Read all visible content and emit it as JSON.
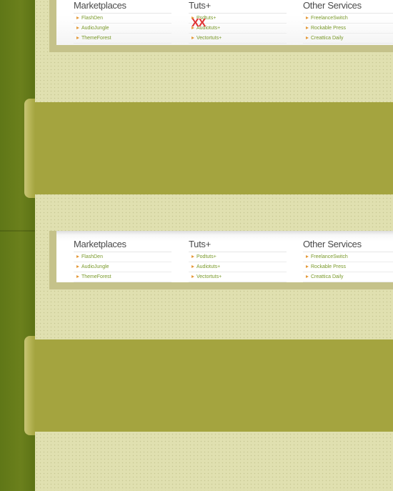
{
  "footer_top": {
    "columns": [
      {
        "title": "Marketplaces",
        "links": [
          "FlashDen",
          "AudioJungle",
          "ThemeForest"
        ]
      },
      {
        "title": "Tuts+",
        "links": [
          "Psdtuts+",
          "Audiotuts+",
          "Vectortuts+"
        ]
      },
      {
        "title": "Other Services",
        "links": [
          "FreelanceSwitch",
          "Rockable Press",
          "Creattica Daily"
        ]
      }
    ],
    "overlay_text": "XX"
  },
  "footer_bottom": {
    "columns": [
      {
        "title": "Marketplaces",
        "links": [
          "FlashDen",
          "AudioJungle",
          "ThemeForest"
        ]
      },
      {
        "title": "Tuts+",
        "links": [
          "Podtuts+",
          "Audiotuts+",
          "Vectortuts+"
        ]
      },
      {
        "title": "Other Services",
        "links": [
          "FreelanceSwitch",
          "Rockable Press",
          "Creattica Daily"
        ]
      }
    ]
  },
  "colors": {
    "sidebar": "#647c1a",
    "background": "#e0e0b0",
    "banner": "#a4a43f",
    "link": "#7a9a2a",
    "arrow": "#e59a3a",
    "overlay": "#e03434"
  }
}
